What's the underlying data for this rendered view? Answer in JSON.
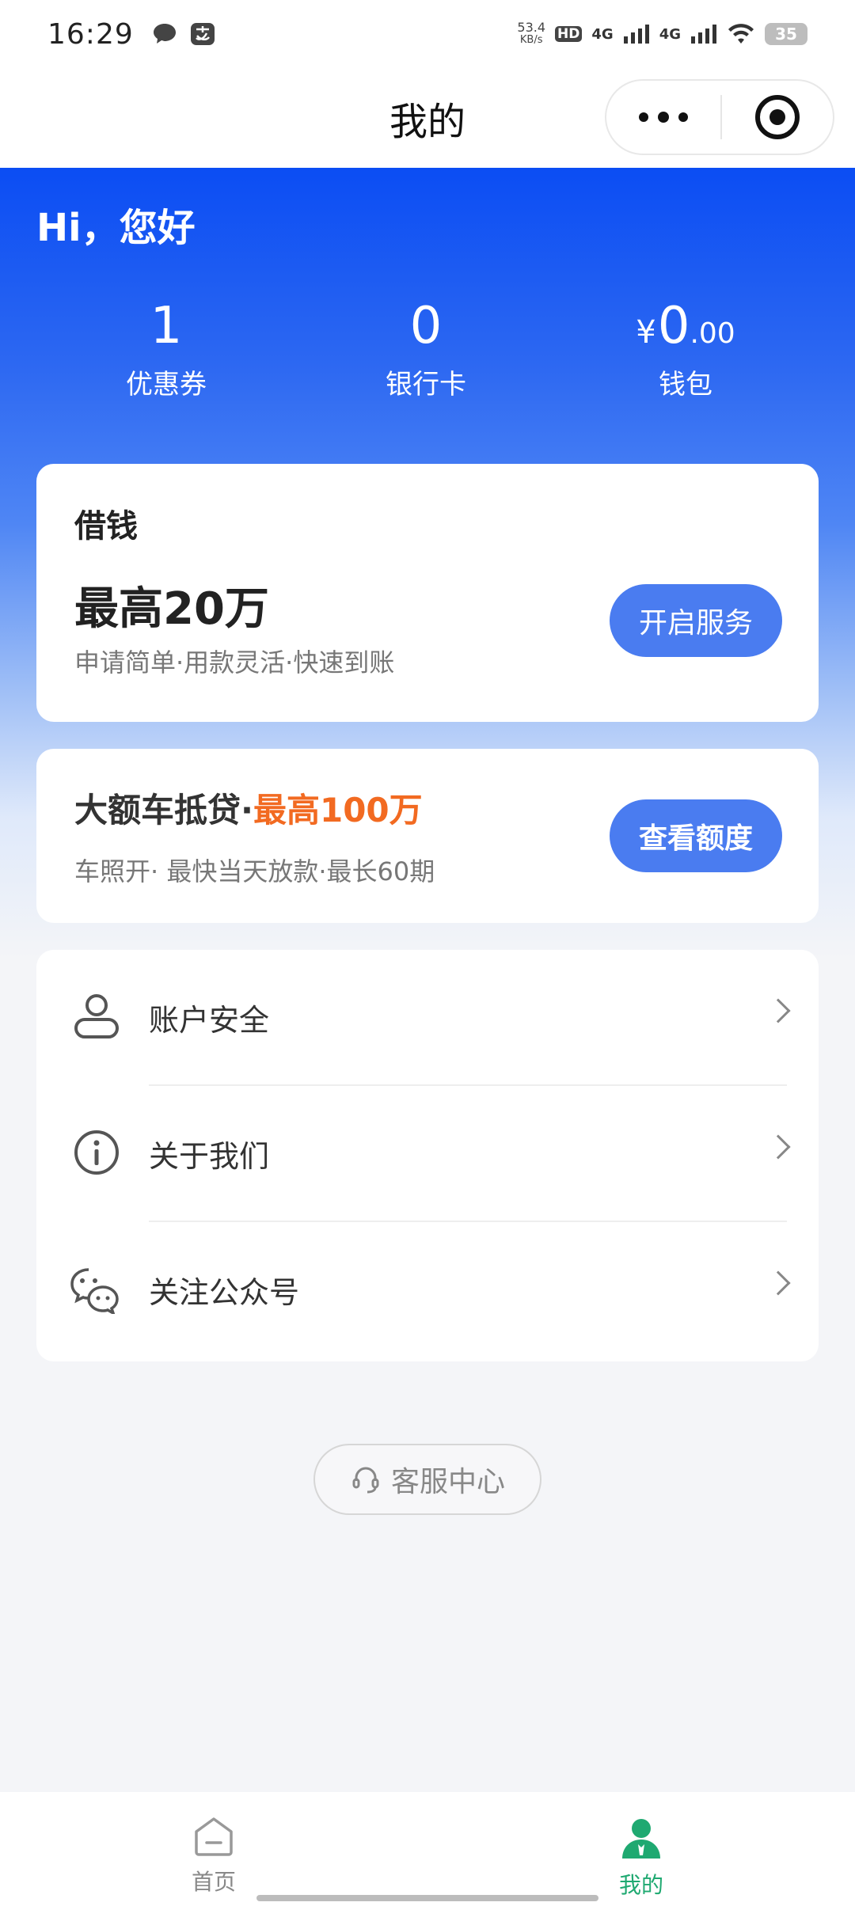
{
  "status_bar": {
    "time": "16:29",
    "net_speed_value": "53.4",
    "net_speed_unit": "KB/s",
    "hd": "HD",
    "signal_1": "4G",
    "signal_2": "4G",
    "battery": "35"
  },
  "nav": {
    "title": "我的"
  },
  "profile": {
    "greeting": "Hi，您好",
    "stats": [
      {
        "value": "1",
        "label": "优惠券"
      },
      {
        "value": "0",
        "label": "银行卡"
      },
      {
        "currency": "¥",
        "value": "0",
        "decimals": ".00",
        "label": "钱包"
      }
    ]
  },
  "loan_card": {
    "title": "借钱",
    "amount": "最高20万",
    "desc": "申请简单·用款灵活·快速到账",
    "button": "开启服务"
  },
  "car_card": {
    "title": "大额车抵贷·",
    "highlight": "最高100万",
    "desc": "车照开· 最快当天放款·最长60期",
    "button": "查看额度",
    "highlight_color": "#f26a21"
  },
  "menu": [
    {
      "label": "账户安全",
      "icon": "user-icon"
    },
    {
      "label": "关于我们",
      "icon": "info-icon"
    },
    {
      "label": "关注公众号",
      "icon": "wechat-icon"
    }
  ],
  "service": {
    "label": "客服中心",
    "icon": "headset-icon"
  },
  "tabs": [
    {
      "label": "首页",
      "icon": "home-icon",
      "active": false
    },
    {
      "label": "我的",
      "icon": "person-icon",
      "active": true
    }
  ],
  "colors": {
    "brand_blue": "#0b4df3",
    "button_blue": "#4a7cf0",
    "active_tab": "#1fa971"
  }
}
